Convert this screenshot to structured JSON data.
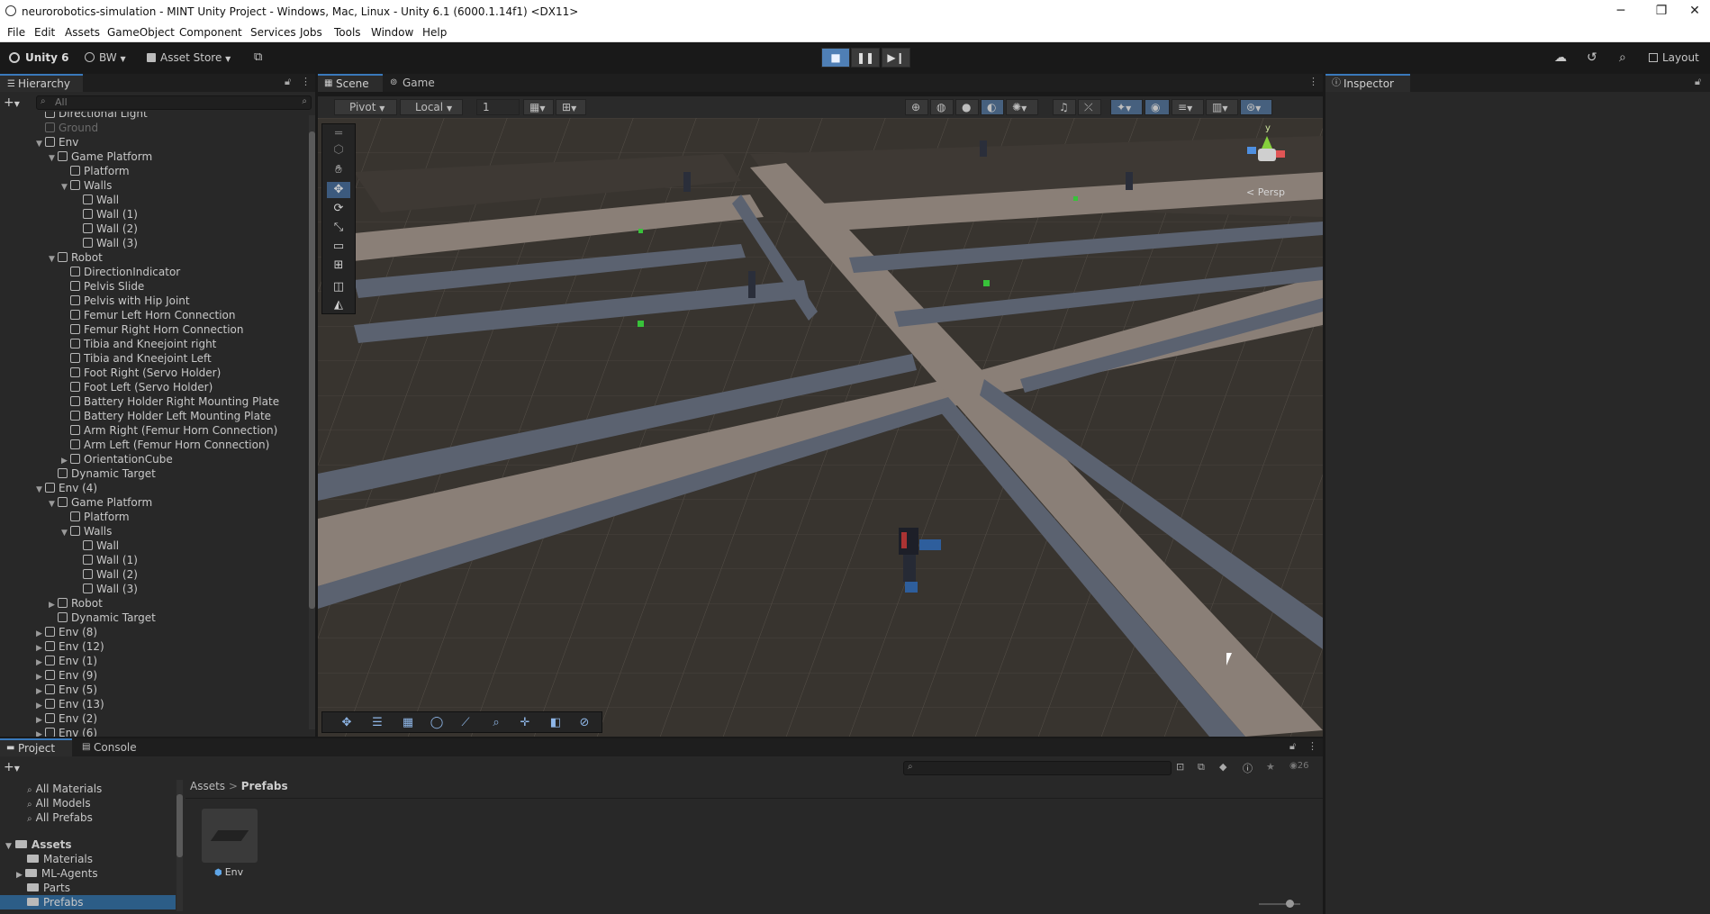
{
  "window": {
    "title": "neurorobotics-simulation - MINT Unity Project - Windows, Mac, Linux - Unity 6.1 (6000.1.14f1) <DX11>",
    "controls": [
      "─",
      "❐",
      "✕"
    ]
  },
  "menu": [
    "File",
    "Edit",
    "Assets",
    "GameObject",
    "Component",
    "Services",
    "Jobs",
    "Tools",
    "Window",
    "Help"
  ],
  "toolbar": {
    "unity_label": "Unity 6",
    "account_label": "BW",
    "asset_store_label": "Asset Store",
    "layout_label": "Layout"
  },
  "hierarchy": {
    "tab": "Hierarchy",
    "search_placeholder": "All",
    "rows": [
      {
        "label": "Directional Light",
        "indent": 0,
        "tri": "",
        "dim": false
      },
      {
        "label": "Ground",
        "indent": 0,
        "tri": "",
        "dim": true
      },
      {
        "label": "Env",
        "indent": 0,
        "tri": "▼",
        "dim": false
      },
      {
        "label": "Game Platform",
        "indent": 1,
        "tri": "▼",
        "dim": false
      },
      {
        "label": "Platform",
        "indent": 2,
        "tri": "",
        "dim": false
      },
      {
        "label": "Walls",
        "indent": 2,
        "tri": "▼",
        "dim": false
      },
      {
        "label": "Wall",
        "indent": 3,
        "tri": "",
        "dim": false
      },
      {
        "label": "Wall (1)",
        "indent": 3,
        "tri": "",
        "dim": false
      },
      {
        "label": "Wall (2)",
        "indent": 3,
        "tri": "",
        "dim": false
      },
      {
        "label": "Wall (3)",
        "indent": 3,
        "tri": "",
        "dim": false
      },
      {
        "label": "Robot",
        "indent": 1,
        "tri": "▼",
        "dim": false
      },
      {
        "label": "DirectionIndicator",
        "indent": 2,
        "tri": "",
        "dim": false
      },
      {
        "label": "Pelvis Slide",
        "indent": 2,
        "tri": "",
        "dim": false
      },
      {
        "label": "Pelvis with Hip Joint",
        "indent": 2,
        "tri": "",
        "dim": false
      },
      {
        "label": "Femur Left Horn Connection",
        "indent": 2,
        "tri": "",
        "dim": false
      },
      {
        "label": "Femur Right Horn Connection",
        "indent": 2,
        "tri": "",
        "dim": false
      },
      {
        "label": "Tibia and Kneejoint right",
        "indent": 2,
        "tri": "",
        "dim": false
      },
      {
        "label": "Tibia and Kneejoint Left",
        "indent": 2,
        "tri": "",
        "dim": false
      },
      {
        "label": "Foot Right (Servo Holder)",
        "indent": 2,
        "tri": "",
        "dim": false
      },
      {
        "label": "Foot Left (Servo Holder)",
        "indent": 2,
        "tri": "",
        "dim": false
      },
      {
        "label": "Battery Holder Right Mounting Plate",
        "indent": 2,
        "tri": "",
        "dim": false
      },
      {
        "label": "Battery Holder Left Mounting Plate",
        "indent": 2,
        "tri": "",
        "dim": false
      },
      {
        "label": "Arm Right (Femur Horn Connection)",
        "indent": 2,
        "tri": "",
        "dim": false
      },
      {
        "label": "Arm Left (Femur Horn Connection)",
        "indent": 2,
        "tri": "",
        "dim": false
      },
      {
        "label": "OrientationCube",
        "indent": 2,
        "tri": "▶",
        "dim": false
      },
      {
        "label": "Dynamic Target",
        "indent": 1,
        "tri": "",
        "dim": false
      },
      {
        "label": "Env (4)",
        "indent": 0,
        "tri": "▼",
        "dim": false
      },
      {
        "label": "Game Platform",
        "indent": 1,
        "tri": "▼",
        "dim": false
      },
      {
        "label": "Platform",
        "indent": 2,
        "tri": "",
        "dim": false
      },
      {
        "label": "Walls",
        "indent": 2,
        "tri": "▼",
        "dim": false
      },
      {
        "label": "Wall",
        "indent": 3,
        "tri": "",
        "dim": false
      },
      {
        "label": "Wall (1)",
        "indent": 3,
        "tri": "",
        "dim": false
      },
      {
        "label": "Wall (2)",
        "indent": 3,
        "tri": "",
        "dim": false
      },
      {
        "label": "Wall (3)",
        "indent": 3,
        "tri": "",
        "dim": false
      },
      {
        "label": "Robot",
        "indent": 1,
        "tri": "▶",
        "dim": false
      },
      {
        "label": "Dynamic Target",
        "indent": 1,
        "tri": "",
        "dim": false
      },
      {
        "label": "Env (8)",
        "indent": 0,
        "tri": "▶",
        "dim": false
      },
      {
        "label": "Env (12)",
        "indent": 0,
        "tri": "▶",
        "dim": false
      },
      {
        "label": "Env (1)",
        "indent": 0,
        "tri": "▶",
        "dim": false
      },
      {
        "label": "Env (9)",
        "indent": 0,
        "tri": "▶",
        "dim": false
      },
      {
        "label": "Env (5)",
        "indent": 0,
        "tri": "▶",
        "dim": false
      },
      {
        "label": "Env (13)",
        "indent": 0,
        "tri": "▶",
        "dim": false
      },
      {
        "label": "Env (2)",
        "indent": 0,
        "tri": "▶",
        "dim": false
      },
      {
        "label": "Env (6)",
        "indent": 0,
        "tri": "▶",
        "dim": false
      }
    ]
  },
  "scene": {
    "tabs": [
      "Scene",
      "Game"
    ],
    "pivot_label": "Pivot",
    "local_label": "Local",
    "grid_snap_value": "1",
    "persp_label": "< Persp",
    "gizmo_axis": "y"
  },
  "inspector": {
    "tab": "Inspector"
  },
  "project": {
    "tabs": [
      "Project",
      "Console"
    ],
    "breadcrumb": [
      "Assets",
      "Prefabs"
    ],
    "asset_count": "26",
    "favorites": [
      "All Materials",
      "All Models",
      "All Prefabs"
    ],
    "assets_root": "Assets",
    "folders": [
      "Materials",
      "ML-Agents",
      "Parts",
      "Prefabs"
    ],
    "items": [
      {
        "label": "Env"
      }
    ]
  },
  "colors": {
    "accent": "#3a79bb",
    "selection": "#2c5d87"
  }
}
